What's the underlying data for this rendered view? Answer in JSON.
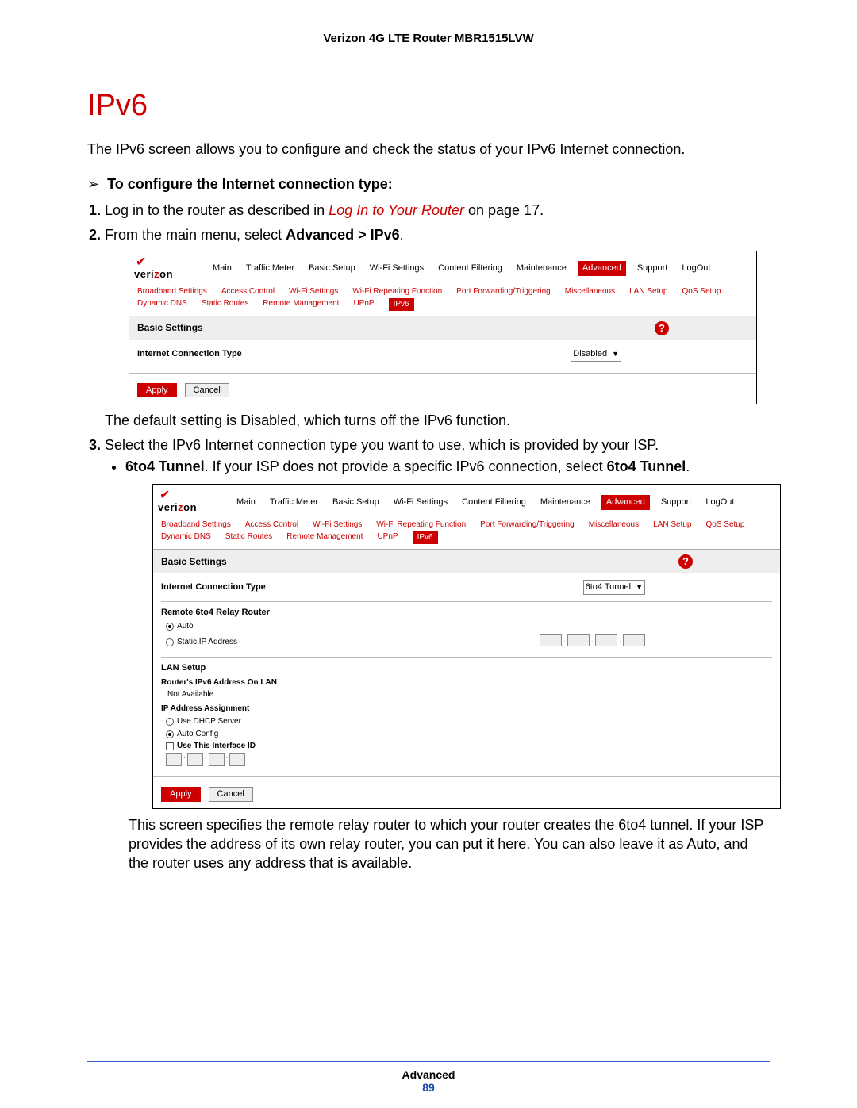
{
  "doc": {
    "header": "Verizon 4G LTE Router MBR1515LVW",
    "title": "IPv6",
    "intro": "The IPv6 screen allows you to configure and check the status of your IPv6 Internet connection.",
    "task_heading": "To configure the Internet connection type:",
    "step1_pre": "Log in to the router as described in ",
    "step1_link": "Log In to Your Router",
    "step1_post": " on page 17.",
    "step2_pre": "From the main menu, select ",
    "step2_bold": "Advanced > IPv6",
    "step2_post": ".",
    "after_shot1": "The default setting is Disabled, which turns off the IPv6 function.",
    "step3": "Select the IPv6 Internet connection type you want to use, which is provided by your ISP.",
    "bullet1_bold1": "6to4 Tunnel",
    "bullet1_mid": ". If your ISP does not provide a specific IPv6 connection, select ",
    "bullet1_bold2": "6to4 Tunnel",
    "bullet1_post": ".",
    "after_shot2": "This screen specifies the remote relay router to which your router creates the 6to4 tunnel. If your ISP provides the address of its own relay router, you can put it here. You can also leave it as Auto, and the router uses any address that is available.",
    "footer_section": "Advanced",
    "footer_page": "89"
  },
  "router": {
    "logo_text_pre": "veri",
    "logo_text_z": "z",
    "logo_text_post": "on",
    "top_tabs": [
      "Main",
      "Traffic Meter",
      "Basic Setup",
      "Wi-Fi Settings",
      "Content Filtering",
      "Maintenance",
      "Advanced",
      "Support",
      "LogOut"
    ],
    "top_active": "Advanced",
    "sub_row1": [
      "Broadband Settings",
      "Access Control",
      "Wi-Fi Settings",
      "Wi-Fi Repeating Function",
      "Port Forwarding/Triggering",
      "Miscellaneous",
      "LAN Setup",
      "QoS Setup"
    ],
    "sub_row2": [
      "Dynamic DNS",
      "Static Routes",
      "Remote Management",
      "UPnP",
      "IPv6"
    ],
    "sub_active": "IPv6",
    "section_title": "Basic Settings",
    "ict_label": "Internet Connection Type",
    "ict_value_disabled": "Disabled",
    "ict_value_6to4": "6to4 Tunnel",
    "apply": "Apply",
    "cancel": "Cancel",
    "relay_heading": "Remote 6to4 Relay Router",
    "relay_auto": "Auto",
    "relay_static": "Static IP Address",
    "lan_heading": "LAN Setup",
    "lan_addr_label": "Router's IPv6 Address On LAN",
    "lan_addr_value": "Not Available",
    "ip_assign_label": "IP Address Assignment",
    "ip_assign_dhcp": "Use DHCP Server",
    "ip_assign_auto": "Auto Config",
    "iface_id_label": "Use This Interface ID"
  }
}
